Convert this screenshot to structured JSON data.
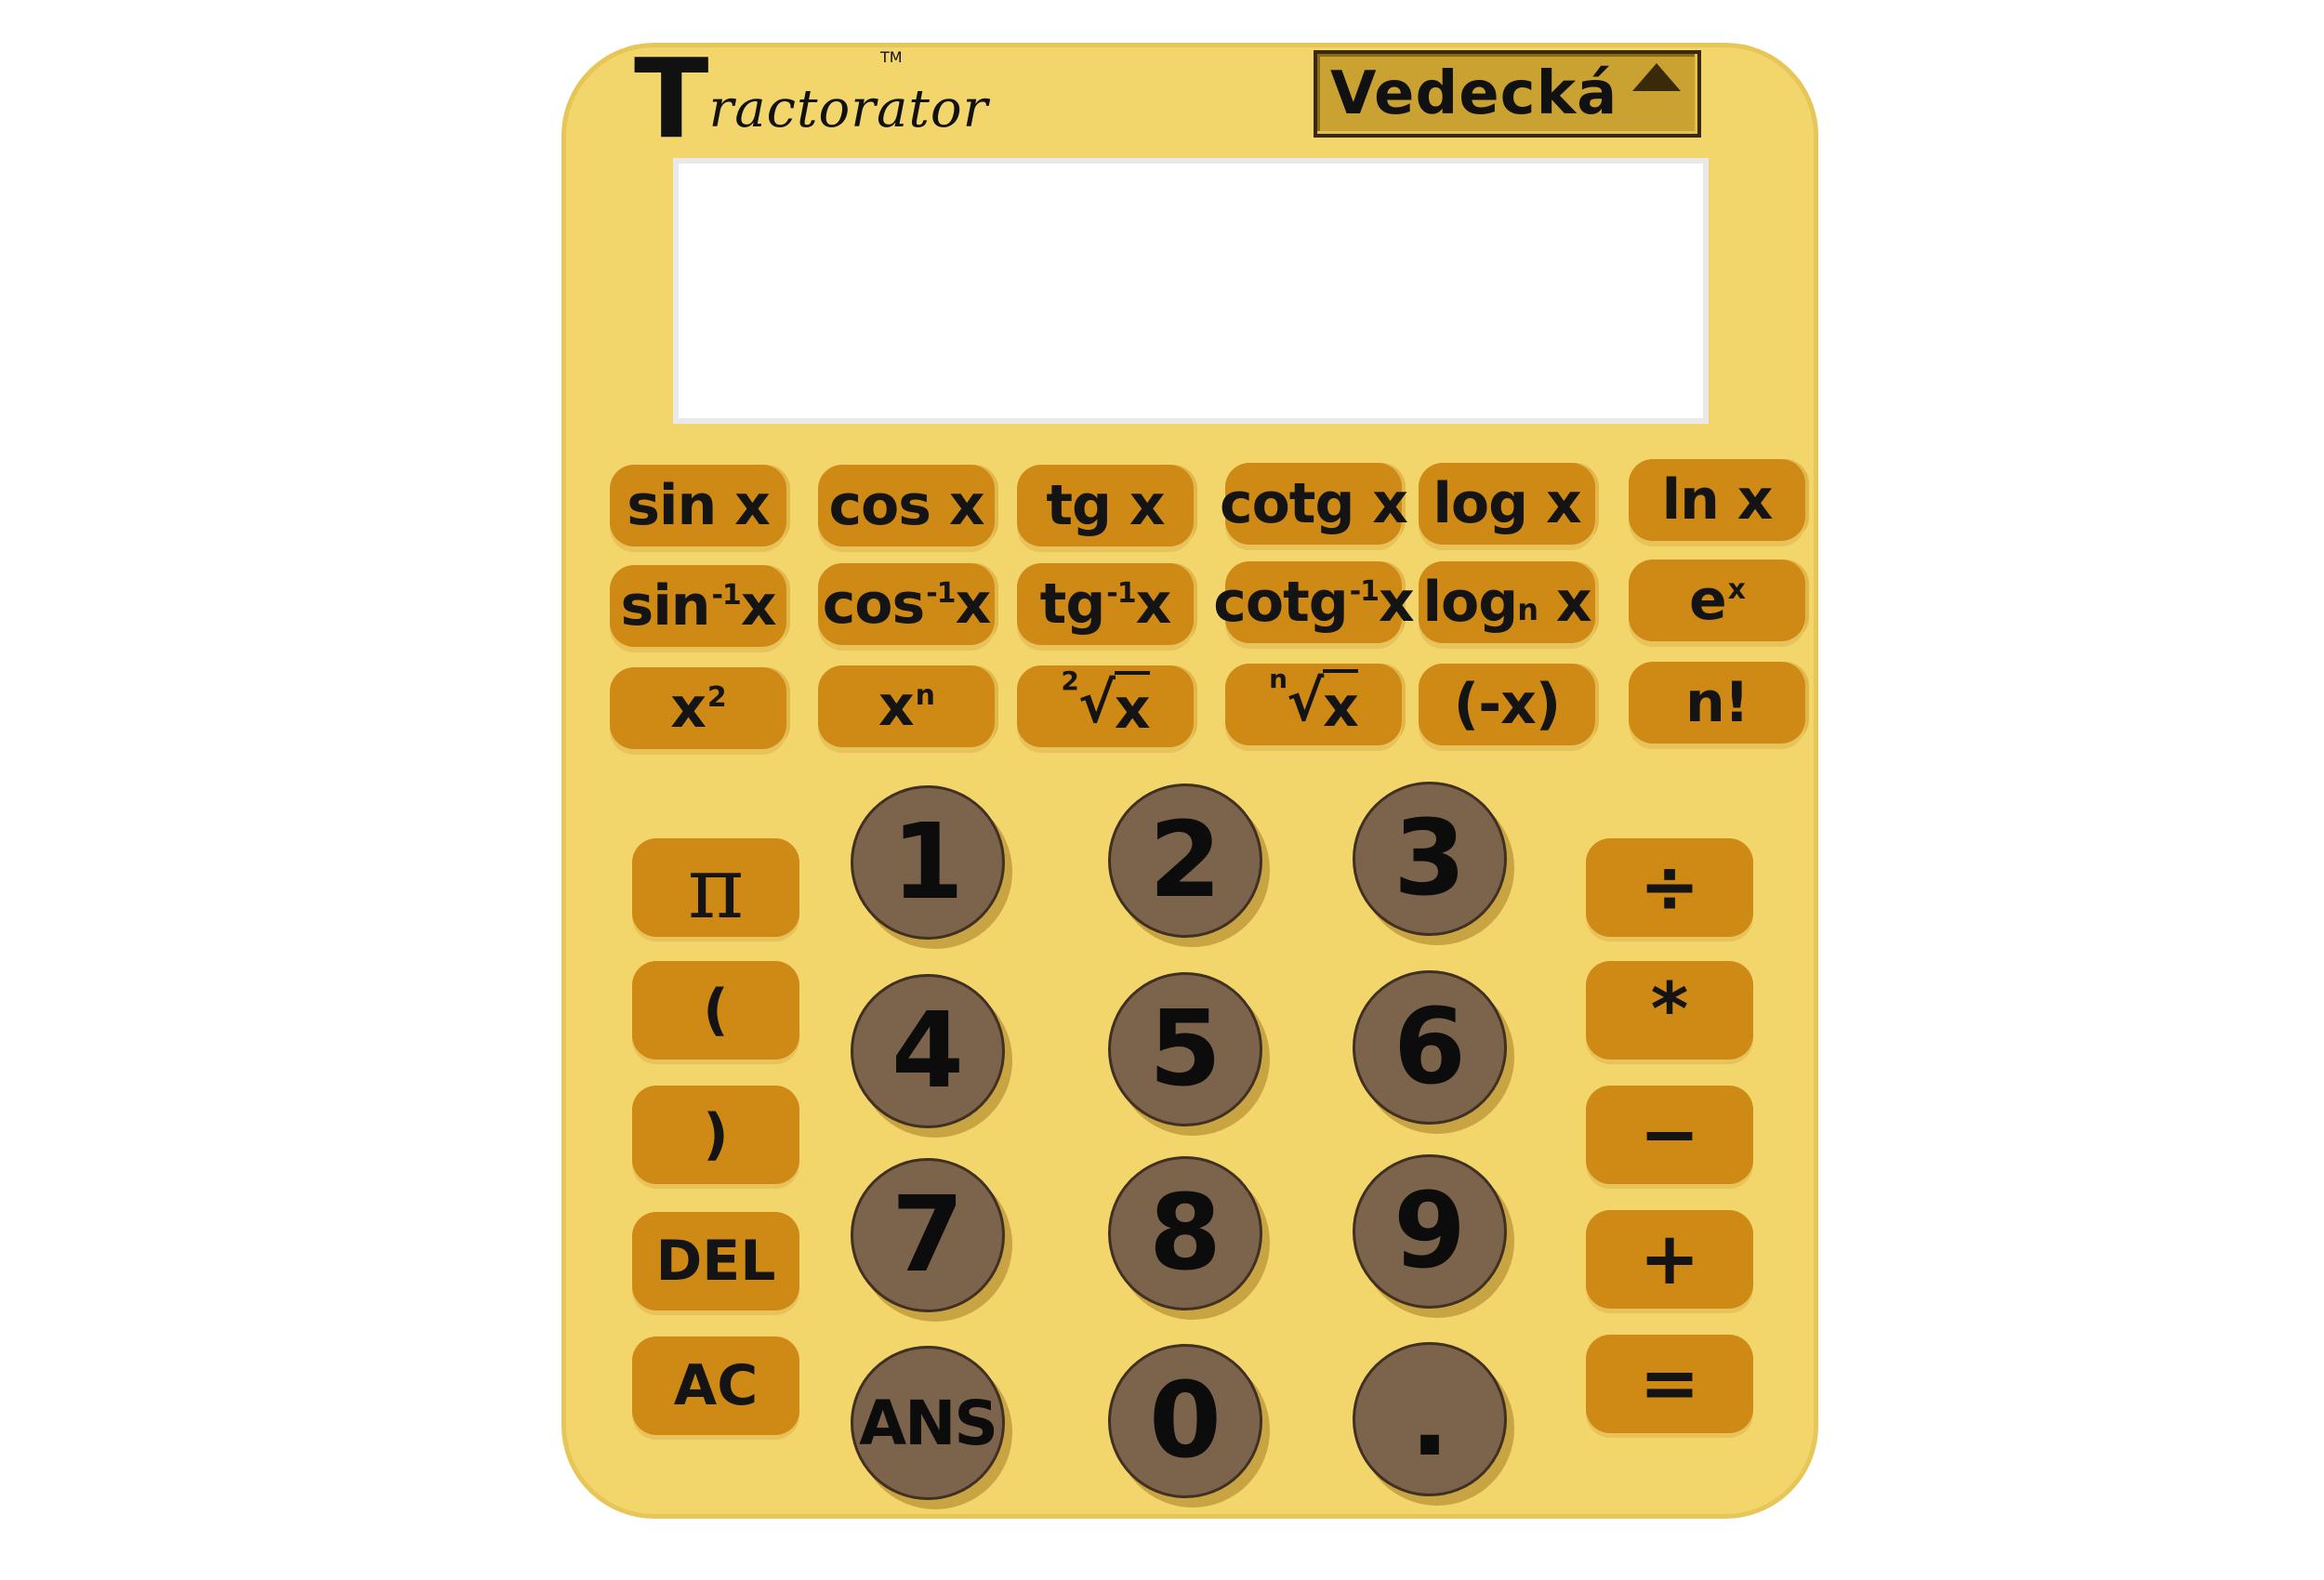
{
  "brand": {
    "first_letter": "T",
    "rest": "ractorator",
    "tm": "TM"
  },
  "mode": {
    "label": "Vedecká",
    "arrow_icon": "triangle-up-icon"
  },
  "display": {
    "value": ""
  },
  "functions": {
    "row1": [
      "sin x",
      "cos x",
      "tg x",
      "cotg x",
      "log x",
      "ln x"
    ],
    "row2": {
      "asin": {
        "base": "sin",
        "sup": "-1",
        "tail": "x"
      },
      "acos": {
        "base": "cos",
        "sup": "-1",
        "tail": "x"
      },
      "atg": {
        "base": "tg",
        "sup": "-1",
        "tail": "x"
      },
      "acotg": {
        "base": "cotg",
        "sup": "-1",
        "tail": "x"
      },
      "logn": {
        "base": "log",
        "sub": "n",
        "tail": "x"
      },
      "exp": {
        "base": "e",
        "sup": "x"
      }
    },
    "row3": {
      "square": {
        "base": "x",
        "sup": "2"
      },
      "power": {
        "base": "x",
        "sup": "n"
      },
      "sqrt": {
        "index": "2",
        "radicand": "x",
        "symbol": "√"
      },
      "nroot": {
        "index": "n",
        "radicand": "x",
        "symbol": "√"
      },
      "negate": "(-x)",
      "factorial": "n!"
    }
  },
  "left_keys": {
    "pi": "π",
    "open_paren": "(",
    "close_paren": ")",
    "del": "DEL",
    "ac": "AC"
  },
  "numpad": [
    "1",
    "2",
    "3",
    "4",
    "5",
    "6",
    "7",
    "8",
    "9",
    "ANS",
    "0",
    "."
  ],
  "operators": {
    "divide": "÷",
    "multiply": "*",
    "minus": "−",
    "plus": "+",
    "equals": "="
  },
  "colors": {
    "body": "#f2d66c",
    "key": "#cf8a16",
    "numkey": "#7c634c",
    "mode": "#c9a231"
  }
}
